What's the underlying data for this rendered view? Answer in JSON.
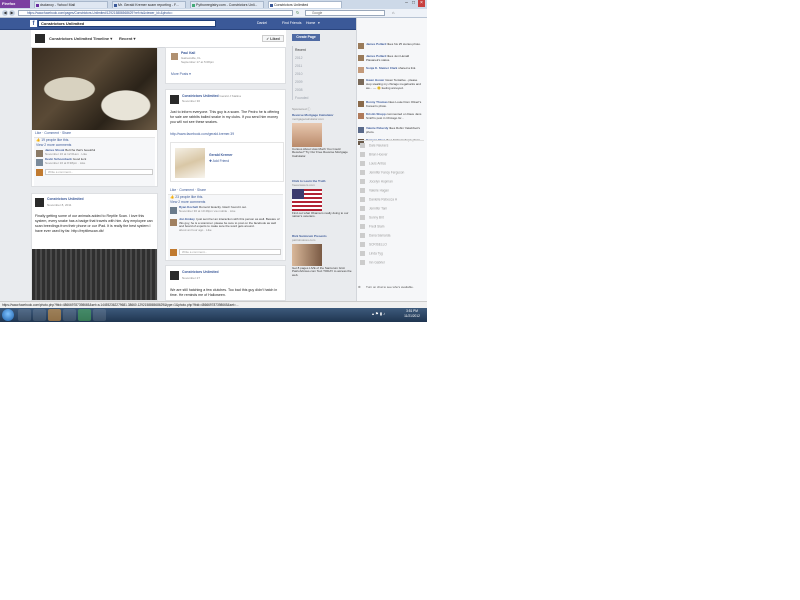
{
  "browser": {
    "menu_label": "Firefox",
    "tabs": [
      {
        "label": "dsclanoy - Yahoo! Mail"
      },
      {
        "label": "Mr. Gerald Kremer scam reporting - F..."
      },
      {
        "label": "Pythonregistry.com - Constrictors Unli..."
      },
      {
        "label": "Constrictors Unlimited",
        "active": true
      }
    ],
    "url": "https://www.facebook.com/pages/Constrictors-Unlimited/129215886568629?ref=ts&viewer_id=&photo=",
    "search_placeholder": "Google"
  },
  "fb": {
    "search_value": "Constrictors Unlimited",
    "nav": [
      "Daniel",
      "Find Friends",
      "Home"
    ],
    "page_name": "Constrictors Unlimited",
    "tabs": [
      "Timeline",
      "Recent"
    ],
    "liked_label": "✓ Liked"
  },
  "left_col": {
    "post1": {
      "actions": "Like · Comment · Share",
      "likes": "19 people like this.",
      "view_comments": "View 2 more comments",
      "comments": [
        {
          "author": "James Shook",
          "text": "Bet'cha that's beautiful",
          "meta": "November 16 at 12:01am · Like"
        },
        {
          "author": "Kevin Schoonbeck",
          "text": "Good luck",
          "meta": "November 16 at 8:38pm · Like"
        }
      ],
      "comment_placeholder": "Write a comment..."
    },
    "post2": {
      "author": "Constrictors Unlimited",
      "date": "November 8, 2011",
      "text": "Finally getting some of our animals added to Reptile Scan. I love this system, every snake has a badge that travels with him. Any employee can scan breedings from their phone or our iPad. It is really the best system I have ever used by far. http://reptilescan.db/"
    }
  },
  "mid_col": {
    "top": {
      "author": "Paul Kail",
      "sub": "Gainesville, FL",
      "date": "September 17 at 5:08pm",
      "more": "More Posts"
    },
    "scam_post": {
      "author": "Constrictors Unlimited",
      "with": "Gerald J Stalina",
      "date": "November 30",
      "text": "Just to inform everyone. This guy is a scam. The Pedro he is offering for sale are rabbits balled snake in my clubs. If you send him money you will not see these snakes.",
      "link": "http://www.facebook.com/gerald.kremer.39",
      "profile_name": "Gerald Kremer",
      "add_friend": "Add Friend",
      "actions": "Like · Comment · Share",
      "likes": "23 people like this.",
      "view_comments": "View 2 more comments",
      "comments": [
        {
          "author": "Ryan Kochelt",
          "text": "Rumors! Exactly. Glad I found it out.",
          "meta": "November 30 at 10:49pm via mobile · Like"
        },
        {
          "author": "Jon Emkey",
          "text": "I just sent her an interaction with this person as well. Beware of this guy, he is a scammer. please be sure to post on the facebook as well and board of experts to make sure the word gets around.",
          "meta": "about an hour ago · Like"
        }
      ],
      "comment_placeholder": "Write a comment..."
    },
    "post3": {
      "author": "Constrictors Unlimited",
      "date": "November 27",
      "text": "We are still hatching a few clutches. Too bad this guy didn't hatch in time. He reminds me of Halloween."
    }
  },
  "timeline": {
    "create_page": "Create Page",
    "years": [
      "Recent",
      "2012",
      "2011",
      "2010",
      "2009",
      "2008",
      "Founded"
    ]
  },
  "ads": {
    "sponsored": "Sponsored",
    "items": [
      {
        "title": "Reverse Mortgage Calculator",
        "url": "mortgagecalculator.com",
        "text": "Curious About How Much You Could Receive? Try Our Free Reverse Mortgage Calculator."
      },
      {
        "title": "Click to Learn the Truth",
        "url": "freeanswers.com",
        "text": "Find out what Obama is really doing to our nation's veterans."
      },
      {
        "title": "Rick Santorum Presents",
        "url": "patriotvoices.com",
        "text": "Get 8 pages LIVE of the Santorum Grid. PatriotVoices.com Text TODAY to access the web."
      }
    ]
  },
  "ticker": [
    {
      "name": "James Pollard",
      "text": "likes his 25 stories photo."
    },
    {
      "name": "James Pollard",
      "text": "likes Jeni Herald Plasanek's status."
    },
    {
      "name": "Sonja K. Steiner Clark",
      "text": "shared a link."
    },
    {
      "name": "Gwen Hosier",
      "text": "Gwen Tentative - please stop stealing my chicago megabucks and we... — 😊 feeling annoyed."
    },
    {
      "name": "Ronny Thomas",
      "text": "likes Louie Dom Oliveri's Korean's photo."
    },
    {
      "name": "Kristin Shupp",
      "text": "commented on Dave Jans Smith's post in Chicago Gr..."
    },
    {
      "name": "Valerie Peberdy",
      "text": "likes Robin Yakebfoot's photo."
    },
    {
      "name": "Dwayne Shea",
      "text": "likes Kriland shop's photo."
    }
  ],
  "chat": [
    "Dale Neukers",
    "Brian Hoover",
    "Louis Antico",
    "Jennifer Fancy Ferguson",
    "Jocelyn Hopman",
    "Valerie Hagan",
    "Danielle Rebecca H",
    "Jennifer Tam",
    "Sunny Brit",
    "Fredi Slam",
    "Dana Samarda",
    "SCRISELLO",
    "Linda Tyg",
    "Inn Gabriel"
  ],
  "chat_footer": "Turn on chat to see who's available.",
  "status_url": "https://www.facebook.com/photo.php?fbid=486669787398665&set=a.144552362279681.38660.129215886568629&type=1&photo.php?fbid=486669787398665&set=...",
  "clock": {
    "time": "3:51 PM",
    "date": "11/21/2012"
  }
}
